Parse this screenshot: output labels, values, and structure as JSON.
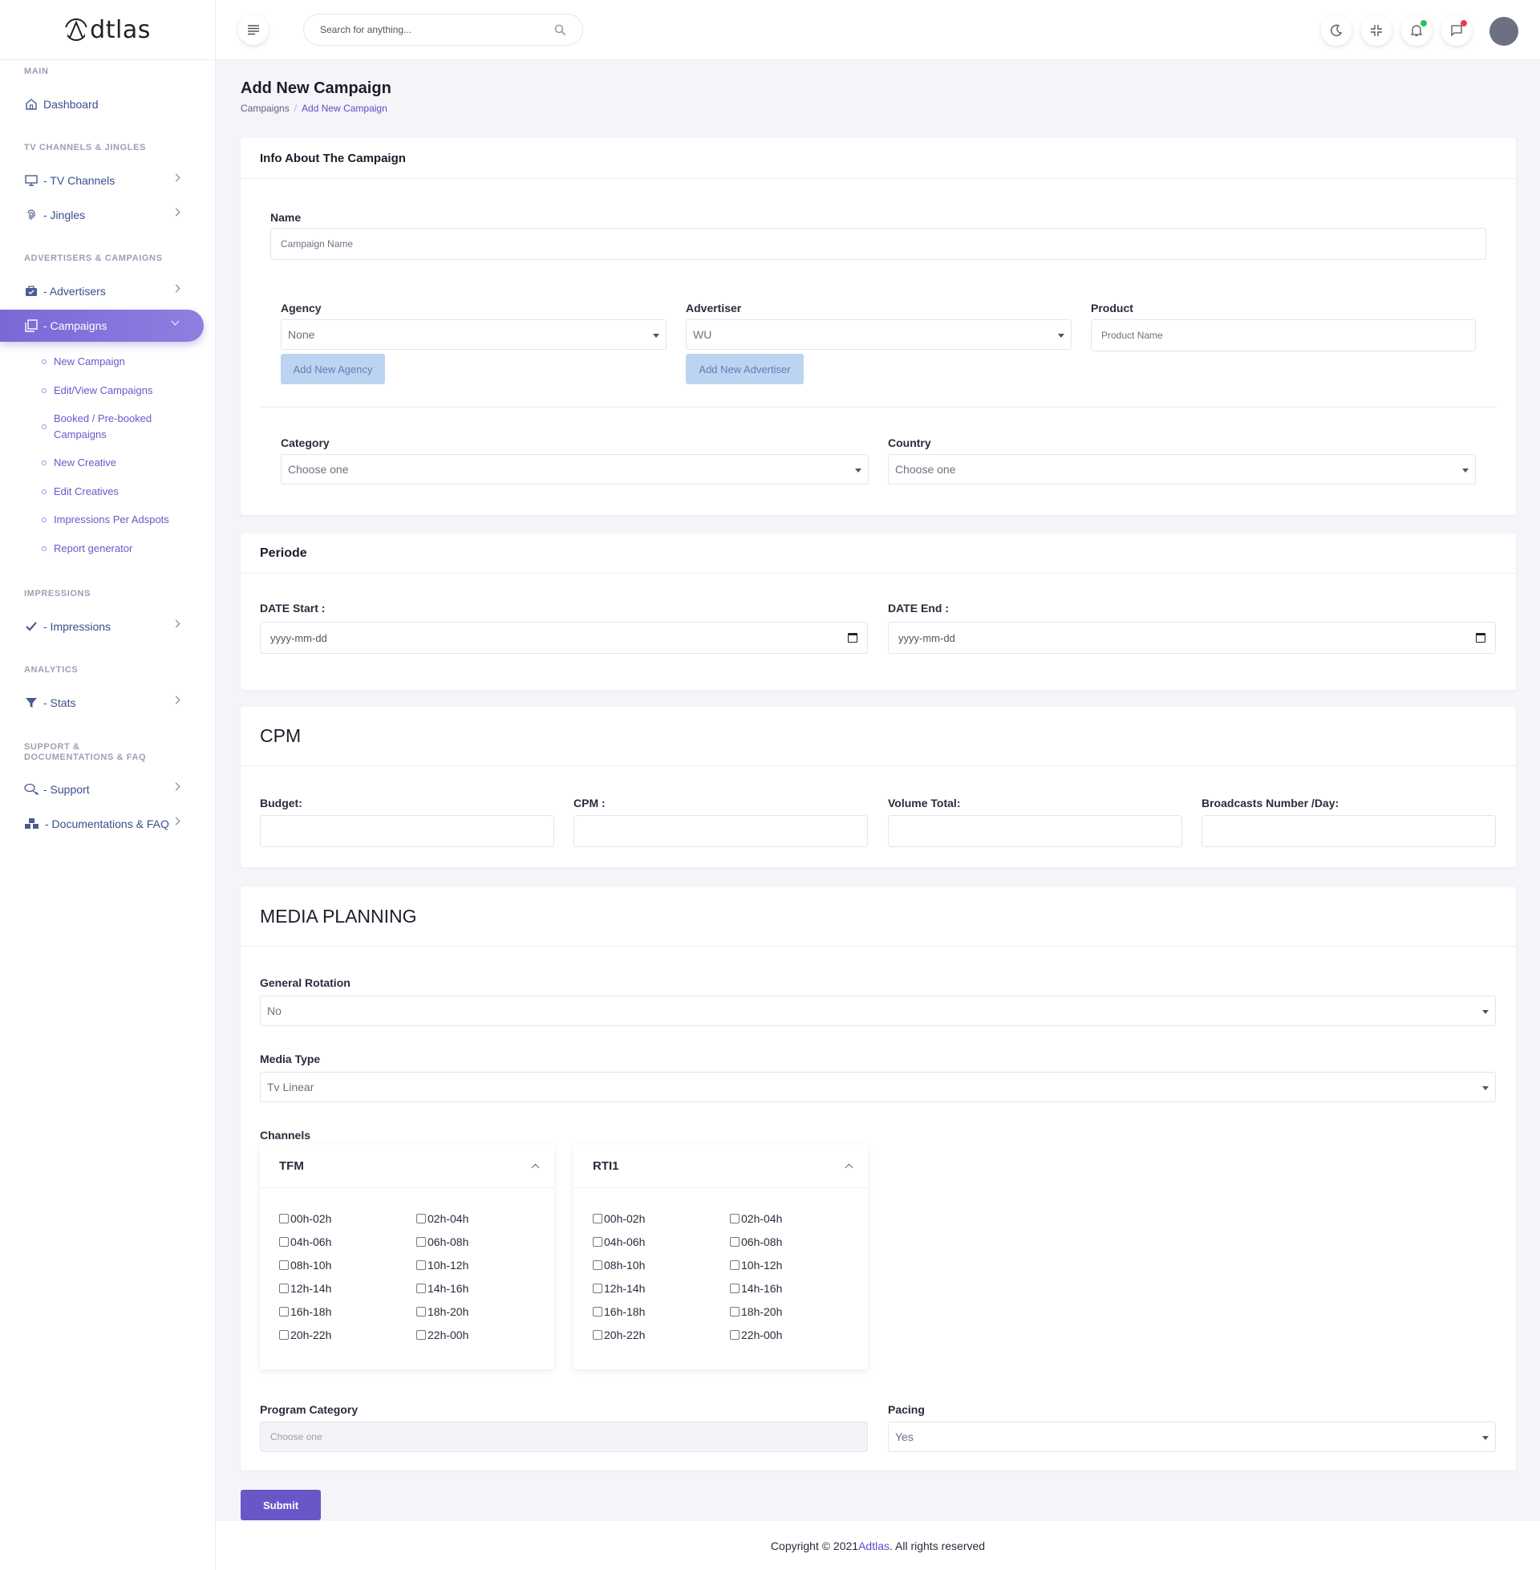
{
  "app": {
    "logo_text": "dtlas"
  },
  "sidebar": {
    "sections": {
      "main": "Main",
      "tv": "TV CHANNELS & JINGLES",
      "adv": "ADVERTISERS & CAMPAIGNS",
      "impr": "IMPRESSIONS",
      "analytics": "ANALYTICS",
      "support": "SUPPORT & DOCUMENTATIONS & FAQ"
    },
    "items": {
      "dashboard": "Dashboard",
      "tv_channels": "- TV Channels",
      "jingles": "- Jingles",
      "advertisers": "- Advertisers",
      "campaigns": "- Campaigns",
      "impressions": "- Impressions",
      "stats": "- Stats",
      "support": "- Support",
      "docs": "- Documentations & FAQ"
    },
    "campaign_subitems": [
      "New Campaign",
      "Edit/View Campaigns",
      "Booked / Pre-booked Campaigns",
      "New Creative",
      "Edit Creatives",
      "Impressions Per Adspots",
      "Report generator"
    ]
  },
  "header": {
    "search_placeholder": "Search for anything..."
  },
  "page": {
    "title": "Add New Campaign",
    "breadcrumb": [
      "Campaigns",
      "Add New Campaign"
    ]
  },
  "info_card": {
    "title": "Info About The Campaign",
    "name_label": "Name",
    "name_placeholder": "Campaign Name",
    "agency_label": "Agency",
    "agency_value": "None",
    "add_agency": "Add New Agency",
    "advertiser_label": "Advertiser",
    "advertiser_value": "WU",
    "add_advertiser": "Add New Advertiser",
    "product_label": "Product",
    "product_placeholder": "Product Name",
    "category_label": "Category",
    "category_value": "Choose one",
    "country_label": "Country",
    "country_value": "Choose one"
  },
  "period_card": {
    "title": "Periode",
    "start_label": "DATE Start :",
    "start_placeholder": "yyyy-mm-dd",
    "end_label": "DATE End :",
    "end_placeholder": "yyyy-mm-dd"
  },
  "cpm_card": {
    "title": "CPM",
    "budget_label": "Budget:",
    "cpm_label": "CPM :",
    "volume_label": "Volume Total:",
    "broadcasts_label": "Broadcasts Number /Day:"
  },
  "media_card": {
    "title": "MEDIA PLANNING",
    "rotation_label": "General Rotation",
    "rotation_value": "No",
    "media_type_label": "Media Type",
    "media_type_value": "Tv Linear",
    "channels_label": "Channels",
    "channels": [
      {
        "name": "TFM",
        "slots": [
          "00h-02h",
          "02h-04h",
          "04h-06h",
          "06h-08h",
          "08h-10h",
          "10h-12h",
          "12h-14h",
          "14h-16h",
          "16h-18h",
          "18h-20h",
          "20h-22h",
          "22h-00h"
        ]
      },
      {
        "name": "RTI1",
        "slots": [
          "00h-02h",
          "02h-04h",
          "04h-06h",
          "06h-08h",
          "08h-10h",
          "10h-12h",
          "12h-14h",
          "14h-16h",
          "16h-18h",
          "18h-20h",
          "20h-22h",
          "22h-00h"
        ]
      }
    ],
    "program_category_label": "Program Category",
    "program_category_placeholder": "Choose one",
    "pacing_label": "Pacing",
    "pacing_value": "Yes"
  },
  "submit_label": "Submit",
  "footer": {
    "prefix": "Copyright © 2021 ",
    "brand": "Adtlas",
    "suffix": ". All rights reserved"
  },
  "colors": {
    "accent": "#6a56c7",
    "active_gradient": "#8e7fe0",
    "light_button": "#bcd4f1",
    "notification_dot_green": "#27c266",
    "notification_dot_red": "#f0365b"
  },
  "icons": [
    "menu-icon",
    "search-icon",
    "moon-icon",
    "compress-icon",
    "bell-icon",
    "chat-icon",
    "home-icon",
    "monitor-icon",
    "fingerprint-icon",
    "briefcase-icon",
    "window-icon",
    "check-icon",
    "filter-icon",
    "chat-bubbles-icon",
    "cubes-icon",
    "calendar-icon"
  ]
}
